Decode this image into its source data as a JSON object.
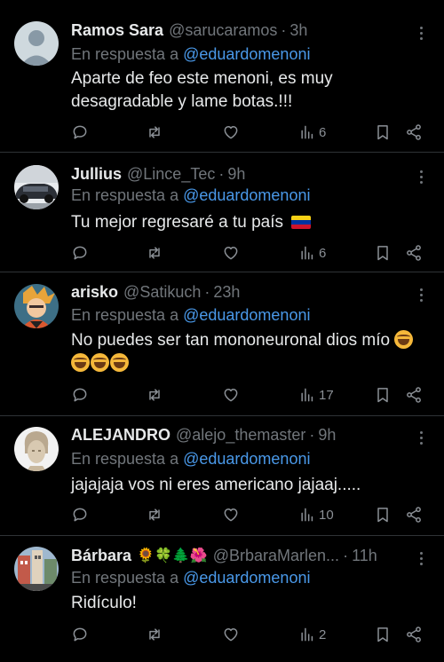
{
  "reply_prefix": "En respuesta a",
  "mention": "@eduardomenoni",
  "dot": "·",
  "colors": {
    "background": "#000000",
    "text": "#e7e9ea",
    "muted": "#71767b",
    "mention": "#4a99e9",
    "divider": "#2f3336"
  },
  "tweets": [
    {
      "name": "Ramos Sara",
      "handle": "@sarucaramos",
      "time": "3h",
      "avatar": "default-avatar",
      "text": "Aparte de feo este menoni, es muy desagradable y lame botas.!!!",
      "views": "6"
    },
    {
      "name": "Jullius",
      "handle": "@Lince_Tec",
      "time": "9h",
      "avatar": "car-photo-avatar",
      "text": "Tu mejor regresaré a tu país",
      "text_emoji": "venezuela-flag",
      "views": "6"
    },
    {
      "name": "arisko",
      "handle": "@Satikuch",
      "time": "23h",
      "avatar": "anime-avatar",
      "text": "No puedes ser tan mononeuronal dios mío",
      "text_emoji": "rolling-on-floor-laughing x4",
      "views": "17"
    },
    {
      "name": "ALEJANDRO",
      "handle": "@alejo_themaster",
      "time": "9h",
      "avatar": "statue-avatar",
      "text": "jajajaja vos ni eres americano jajaaj.....",
      "views": "10"
    },
    {
      "name": "Bárbara",
      "name_emojis": "🌻🍀🌲🌺",
      "handle": "@BrbaraMarlen...",
      "time": "11h",
      "avatar": "building-photo-avatar",
      "text": "Ridículo!",
      "views": "2"
    }
  ]
}
